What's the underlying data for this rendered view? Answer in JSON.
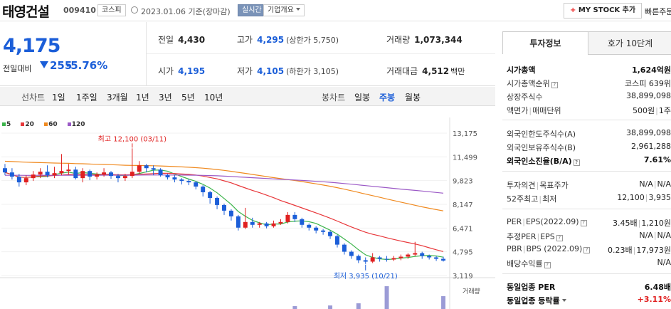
{
  "header": {
    "stock_name": "태영건설",
    "stock_code": "009410",
    "market": "코스피",
    "date_text": "2023.01.06  기준(장마감)",
    "realtime": "실시간",
    "company_info": "기업개요",
    "mystock_plus": "+",
    "mystock_label": "MY STOCK 추가",
    "quick_search": "빠른주문"
  },
  "price": {
    "current": "4,175",
    "change_label": "전일대비",
    "change_value": "255",
    "change_rate": "-5.76%",
    "colors": {
      "down": "#1b5ed8",
      "up": "#e02020"
    }
  },
  "quote": {
    "prev_close": {
      "label": "전일",
      "value": "4,430"
    },
    "high": {
      "label": "고가",
      "value": "4,295",
      "limit": "(상한가 5,750)"
    },
    "volume": {
      "label": "거래량",
      "value": "1,073,344"
    },
    "open": {
      "label": "시가",
      "value": "4,195"
    },
    "low": {
      "label": "저가",
      "value": "4,105",
      "limit": "(하한가 3,105)"
    },
    "amount": {
      "label": "거래대금",
      "value": "4,512",
      "unit": "백만"
    }
  },
  "period_bar": {
    "line_label": "선차트",
    "line_options": [
      "1일",
      "1주일",
      "3개월",
      "1년",
      "3년",
      "5년",
      "10년"
    ],
    "candle_label": "봉차트",
    "candle_options": [
      "일봉",
      "주봉",
      "월봉"
    ],
    "selected_candle": "주봉"
  },
  "chart_data": {
    "type": "candlestick",
    "interval": "weekly",
    "legend": [
      {
        "name": "5",
        "color": "#3cb44b"
      },
      {
        "name": "20",
        "color": "#e8373a"
      },
      {
        "name": "60",
        "color": "#f08a20"
      },
      {
        "name": "120",
        "color": "#9b59c6"
      }
    ],
    "y_ticks": [
      13175,
      11499,
      9823,
      8147,
      6471,
      4795,
      3119
    ],
    "ylim": [
      3119,
      13175
    ],
    "annotations": {
      "high": {
        "label": "최고 12,100 (03/11)",
        "value": 12100
      },
      "low": {
        "label": "최저 3,935 (10/21)",
        "value": 3935
      }
    },
    "volume_label": "거래량",
    "candles": [
      [
        10700,
        10400,
        11000,
        10200
      ],
      [
        10400,
        10100,
        10700,
        9900
      ],
      [
        10100,
        9700,
        10300,
        9400
      ],
      [
        9700,
        10000,
        10200,
        9500
      ],
      [
        10000,
        10250,
        10500,
        9800
      ],
      [
        10250,
        10450,
        10700,
        10000
      ],
      [
        10450,
        10200,
        10900,
        10050
      ],
      [
        10200,
        10350,
        10800,
        10000
      ],
      [
        10350,
        10500,
        11700,
        10200
      ],
      [
        10500,
        10600,
        11000,
        10250
      ],
      [
        10600,
        10000,
        10800,
        9900
      ],
      [
        10000,
        10500,
        10700,
        9700
      ],
      [
        10500,
        10100,
        10600,
        9850
      ],
      [
        10100,
        10250,
        10400,
        9900
      ],
      [
        10250,
        10400,
        10700,
        10100
      ],
      [
        10400,
        10150,
        10500,
        9950
      ],
      [
        10150,
        10000,
        10300,
        9700
      ],
      [
        10000,
        10150,
        10300,
        9800
      ],
      [
        10150,
        10450,
        12100,
        10000
      ],
      [
        10450,
        10900,
        11200,
        10300
      ],
      [
        10900,
        10700,
        11000,
        10400
      ],
      [
        10700,
        10600,
        10900,
        10200
      ],
      [
        10600,
        10200,
        10700,
        10100
      ],
      [
        10200,
        10050,
        10300,
        9900
      ],
      [
        10050,
        9900,
        10200,
        9700
      ],
      [
        9900,
        9800,
        10000,
        9550
      ],
      [
        9800,
        9700,
        9950,
        9500
      ],
      [
        9700,
        9400,
        9800,
        9200
      ],
      [
        9400,
        9000,
        9500,
        8700
      ],
      [
        9000,
        8600,
        9100,
        8200
      ],
      [
        8600,
        8100,
        8700,
        7800
      ],
      [
        8100,
        7700,
        8200,
        7400
      ],
      [
        7700,
        7300,
        7800,
        7000
      ],
      [
        7300,
        6500,
        7400,
        6300
      ],
      [
        6500,
        6900,
        7900,
        6400
      ],
      [
        6900,
        6700,
        7200,
        6500
      ],
      [
        6700,
        6800,
        6900,
        6500
      ],
      [
        6800,
        6600,
        6900,
        6450
      ],
      [
        6600,
        6800,
        7000,
        6500
      ],
      [
        6800,
        6900,
        7100,
        6700
      ],
      [
        6900,
        7400,
        7600,
        6800
      ],
      [
        7400,
        7100,
        7600,
        6900
      ],
      [
        7100,
        6700,
        7200,
        6500
      ],
      [
        6700,
        6500,
        6800,
        6300
      ],
      [
        6500,
        6300,
        6600,
        6100
      ],
      [
        6300,
        6200,
        6400,
        6000
      ],
      [
        6200,
        5900,
        6300,
        5700
      ],
      [
        5900,
        5300,
        6000,
        5100
      ],
      [
        5300,
        4800,
        5400,
        4600
      ],
      [
        4800,
        4500,
        4900,
        4300
      ],
      [
        4500,
        4200,
        4600,
        4000
      ],
      [
        4200,
        4100,
        4400,
        3935
      ],
      [
        4100,
        4400,
        4700,
        4000
      ],
      [
        4400,
        4300,
        4500,
        4100
      ],
      [
        4300,
        4250,
        4500,
        4100
      ],
      [
        4250,
        4350,
        4500,
        4150
      ],
      [
        4350,
        4450,
        4600,
        4200
      ],
      [
        4450,
        4600,
        4700,
        4300
      ],
      [
        4600,
        4700,
        5500,
        4500
      ],
      [
        4700,
        4500,
        4800,
        4300
      ],
      [
        4500,
        4400,
        4600,
        4250
      ],
      [
        4400,
        4300,
        4500,
        4150
      ],
      [
        4300,
        4175,
        4450,
        4105
      ]
    ]
  },
  "right_panel": {
    "tabs": [
      "투자정보",
      "호가 10단계"
    ],
    "rows_group1": [
      {
        "label": "시가총액",
        "value": "1,624억원"
      },
      {
        "label": "시가총액순위",
        "value": "코스피 639위"
      },
      {
        "label": "상장주식수",
        "value": "38,899,098"
      },
      {
        "label": "액면가",
        "label2": "매매단위",
        "value": "500원",
        "value2": "1주"
      }
    ],
    "rows_group2": [
      {
        "label": "외국인한도주식수(A)",
        "value": "38,899,098"
      },
      {
        "label": "외국인보유주식수(B)",
        "value": "2,961,288"
      },
      {
        "label": "외국인소진율(B/A)",
        "value": "7.61%"
      }
    ],
    "rows_group3": [
      {
        "label": "투자의견",
        "label2": "목표주가",
        "value": "N/A",
        "value2": "N/A"
      },
      {
        "label": "52주최고",
        "label2": "최저",
        "value": "12,100",
        "value2": "3,935"
      }
    ],
    "rows_group4": [
      {
        "label": "PER",
        "label2": "EPS(2022.09)",
        "value": "3.45배",
        "value2": "1,210원"
      },
      {
        "label": "추정PER",
        "label2": "EPS",
        "value": "N/A",
        "value2": "N/A"
      },
      {
        "label": "PBR",
        "label2": "BPS (2022.09)",
        "value": "0.23배",
        "value2": "17,973원"
      },
      {
        "label": "배당수익률",
        "value": "N/A"
      }
    ],
    "rows_group5": [
      {
        "label": "동일업종 PER",
        "value": "6.48배"
      },
      {
        "label": "동일업종 등락률",
        "value": "+3.11%"
      }
    ]
  }
}
